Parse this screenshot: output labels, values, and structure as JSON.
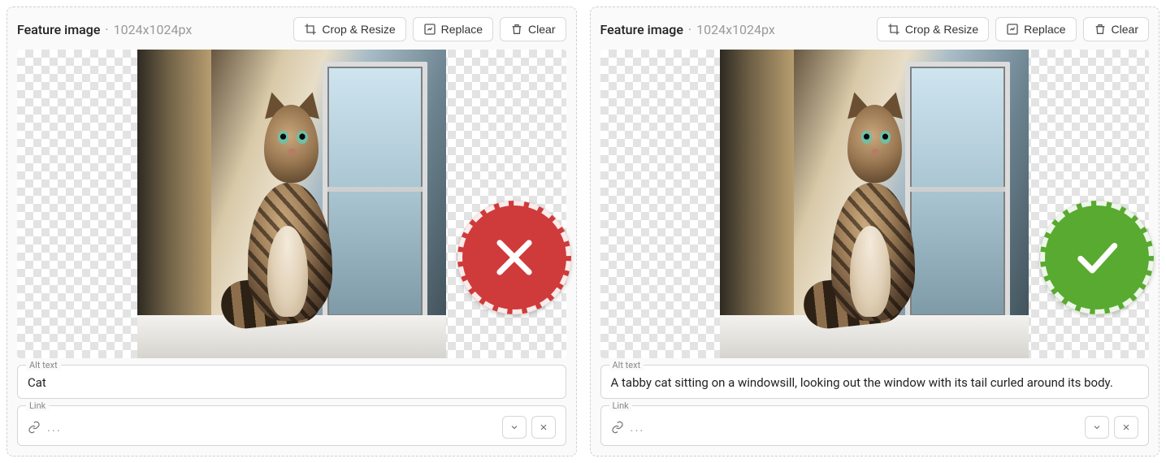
{
  "panels": [
    {
      "header": {
        "title": "Feature image",
        "dimensions": "1024x1024px"
      },
      "buttons": {
        "crop": "Crop & Resize",
        "replace": "Replace",
        "clear": "Clear"
      },
      "alt": {
        "label": "Alt text",
        "value": "Cat"
      },
      "link": {
        "label": "Link",
        "placeholder": "..."
      },
      "badge": "bad"
    },
    {
      "header": {
        "title": "Feature image",
        "dimensions": "1024x1024px"
      },
      "buttons": {
        "crop": "Crop & Resize",
        "replace": "Replace",
        "clear": "Clear"
      },
      "alt": {
        "label": "Alt text",
        "value": "A tabby cat sitting on a windowsill, looking out the window with its tail curled around its body."
      },
      "link": {
        "label": "Link",
        "placeholder": "..."
      },
      "badge": "good"
    }
  ]
}
